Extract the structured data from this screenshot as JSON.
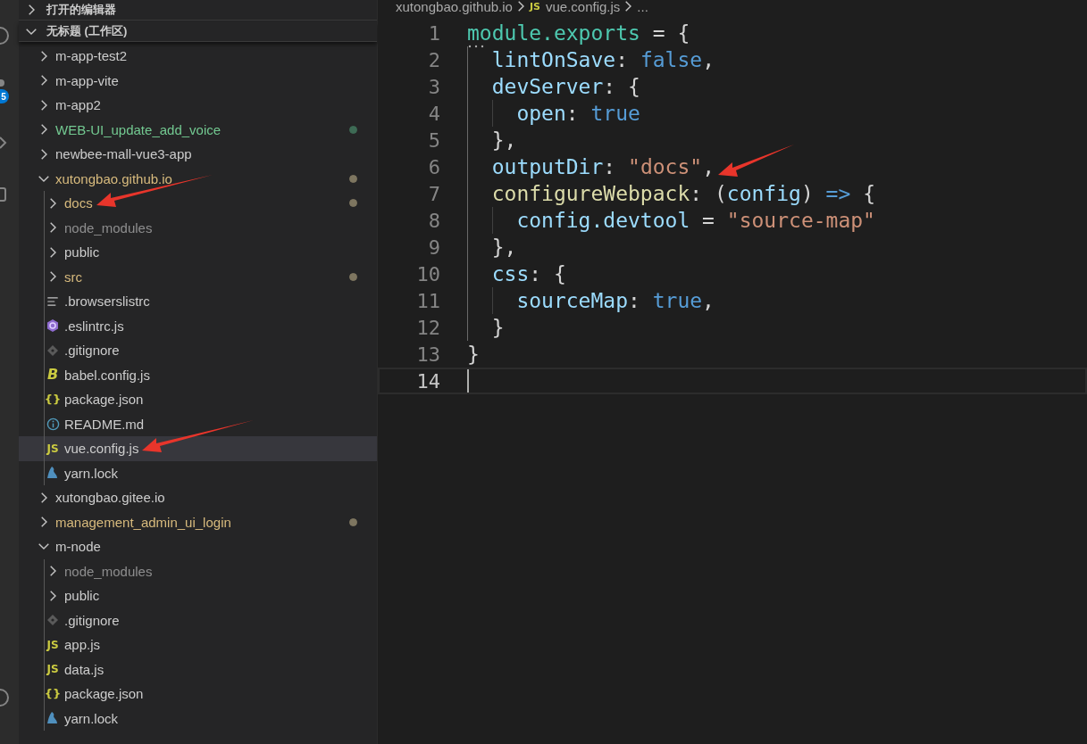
{
  "activity_bar": {
    "badge": "5"
  },
  "sidebar": {
    "sections": [
      {
        "title": "打开的编辑器",
        "expanded": false
      },
      {
        "title": "无标题 (工作区)",
        "expanded": true
      }
    ],
    "tree": [
      {
        "name": "m-app-test2",
        "kind": "folder",
        "expanded": false,
        "modified": false,
        "untracked": false,
        "ignored": false,
        "selected": false,
        "arrow": false
      },
      {
        "name": "m-app-vite",
        "kind": "folder",
        "expanded": false,
        "modified": false,
        "untracked": false,
        "ignored": false,
        "selected": false,
        "arrow": false
      },
      {
        "name": "m-app2",
        "kind": "folder",
        "expanded": false,
        "modified": false,
        "untracked": false,
        "ignored": false,
        "selected": false,
        "arrow": false
      },
      {
        "name": "WEB-UI_update_add_voice",
        "kind": "folder",
        "expanded": false,
        "modified": false,
        "untracked": true,
        "ignored": false,
        "selected": false,
        "arrow": false
      },
      {
        "name": "newbee-mall-vue3-app",
        "kind": "folder",
        "expanded": false,
        "modified": false,
        "untracked": false,
        "ignored": false,
        "selected": false,
        "arrow": false
      },
      {
        "name": "xutongbao.github.io",
        "kind": "folder",
        "expanded": true,
        "modified": true,
        "untracked": false,
        "ignored": false,
        "selected": false,
        "arrow": false,
        "children": [
          {
            "name": "docs",
            "kind": "folder",
            "expanded": false,
            "modified": true,
            "untracked": false,
            "ignored": false,
            "selected": false,
            "arrow": true
          },
          {
            "name": "node_modules",
            "kind": "folder",
            "expanded": false,
            "modified": false,
            "untracked": false,
            "ignored": true,
            "selected": false,
            "arrow": false
          },
          {
            "name": "public",
            "kind": "folder",
            "expanded": false,
            "modified": false,
            "untracked": false,
            "ignored": false,
            "selected": false,
            "arrow": false
          },
          {
            "name": "src",
            "kind": "folder",
            "expanded": false,
            "modified": true,
            "untracked": false,
            "ignored": false,
            "selected": false,
            "arrow": false
          },
          {
            "name": ".browserslistrc",
            "kind": "lines",
            "modified": false,
            "untracked": false,
            "ignored": false,
            "selected": false,
            "arrow": false
          },
          {
            "name": ".eslintrc.js",
            "kind": "eslint",
            "modified": false,
            "untracked": false,
            "ignored": false,
            "selected": false,
            "arrow": false
          },
          {
            "name": ".gitignore",
            "kind": "git",
            "modified": false,
            "untracked": false,
            "ignored": false,
            "selected": false,
            "arrow": false
          },
          {
            "name": "babel.config.js",
            "kind": "babel",
            "icon_text": "B",
            "modified": false,
            "untracked": false,
            "ignored": false,
            "selected": false,
            "arrow": false
          },
          {
            "name": "package.json",
            "kind": "json",
            "icon_text": "{}",
            "modified": false,
            "untracked": false,
            "ignored": false,
            "selected": false,
            "arrow": false
          },
          {
            "name": "README.md",
            "kind": "info",
            "modified": false,
            "untracked": false,
            "ignored": false,
            "selected": false,
            "arrow": false
          },
          {
            "name": "vue.config.js",
            "kind": "js",
            "icon_text": "JS",
            "modified": false,
            "untracked": false,
            "ignored": false,
            "selected": true,
            "arrow": true
          },
          {
            "name": "yarn.lock",
            "kind": "yarn",
            "modified": false,
            "untracked": false,
            "ignored": false,
            "selected": false,
            "arrow": false
          }
        ]
      },
      {
        "name": "xutongbao.gitee.io",
        "kind": "folder",
        "expanded": false,
        "modified": false,
        "untracked": false,
        "ignored": false,
        "selected": false,
        "arrow": false
      },
      {
        "name": "management_admin_ui_login",
        "kind": "folder",
        "expanded": false,
        "modified": true,
        "untracked": false,
        "ignored": false,
        "selected": false,
        "arrow": false
      },
      {
        "name": "m-node",
        "kind": "folder",
        "expanded": true,
        "modified": false,
        "untracked": false,
        "ignored": false,
        "selected": false,
        "arrow": false,
        "children": [
          {
            "name": "node_modules",
            "kind": "folder",
            "expanded": false,
            "modified": false,
            "untracked": false,
            "ignored": true,
            "selected": false,
            "arrow": false
          },
          {
            "name": "public",
            "kind": "folder",
            "expanded": false,
            "modified": false,
            "untracked": false,
            "ignored": false,
            "selected": false,
            "arrow": false
          },
          {
            "name": ".gitignore",
            "kind": "git",
            "modified": false,
            "untracked": false,
            "ignored": false,
            "selected": false,
            "arrow": false
          },
          {
            "name": "app.js",
            "kind": "js",
            "icon_text": "JS",
            "modified": false,
            "untracked": false,
            "ignored": false,
            "selected": false,
            "arrow": false
          },
          {
            "name": "data.js",
            "kind": "js",
            "icon_text": "JS",
            "modified": false,
            "untracked": false,
            "ignored": false,
            "selected": false,
            "arrow": false
          },
          {
            "name": "package.json",
            "kind": "json",
            "icon_text": "{}",
            "modified": false,
            "untracked": false,
            "ignored": false,
            "selected": false,
            "arrow": false
          },
          {
            "name": "yarn.lock",
            "kind": "yarn",
            "modified": false,
            "untracked": false,
            "ignored": false,
            "selected": false,
            "arrow": false
          }
        ]
      }
    ]
  },
  "editor": {
    "breadcrumb": [
      {
        "text": "xutongbao.github.io"
      },
      {
        "text": "vue.config.js",
        "icon_text": "JS"
      },
      {
        "text": "..."
      }
    ],
    "lines": [
      {
        "number": "1",
        "hint": true,
        "current": false,
        "arrow": false,
        "tokens": [
          {
            "kind": "type",
            "text": "module.exports"
          },
          {
            "kind": "punct",
            "text": " = {"
          }
        ]
      },
      {
        "number": "2",
        "hint": false,
        "current": false,
        "arrow": false,
        "tokens": [
          {
            "kind": "prop",
            "text": "  lintOnSave"
          },
          {
            "kind": "punct",
            "text": ": "
          },
          {
            "kind": "keyword",
            "text": "false"
          },
          {
            "kind": "punct",
            "text": ","
          }
        ]
      },
      {
        "number": "3",
        "hint": false,
        "current": false,
        "arrow": false,
        "tokens": [
          {
            "kind": "prop",
            "text": "  devServer"
          },
          {
            "kind": "punct",
            "text": ": {"
          }
        ]
      },
      {
        "number": "4",
        "hint": false,
        "current": false,
        "arrow": false,
        "tokens": [
          {
            "kind": "prop",
            "text": "    open"
          },
          {
            "kind": "punct",
            "text": ": "
          },
          {
            "kind": "keyword",
            "text": "true"
          }
        ]
      },
      {
        "number": "5",
        "hint": false,
        "current": false,
        "arrow": false,
        "tokens": [
          {
            "kind": "punct",
            "text": "  },"
          }
        ]
      },
      {
        "number": "6",
        "hint": false,
        "current": false,
        "arrow": true,
        "tokens": [
          {
            "kind": "prop",
            "text": "  outputDir"
          },
          {
            "kind": "punct",
            "text": ": "
          },
          {
            "kind": "string",
            "text": "\"docs\""
          },
          {
            "kind": "punct",
            "text": ","
          }
        ]
      },
      {
        "number": "7",
        "hint": false,
        "current": false,
        "arrow": false,
        "tokens": [
          {
            "kind": "function",
            "text": "  configureWebpack"
          },
          {
            "kind": "punct",
            "text": ": ("
          },
          {
            "kind": "prop",
            "text": "config"
          },
          {
            "kind": "punct",
            "text": ") "
          },
          {
            "kind": "keyword",
            "text": "=>"
          },
          {
            "kind": "punct",
            "text": " {"
          }
        ]
      },
      {
        "number": "8",
        "hint": false,
        "current": false,
        "arrow": false,
        "tokens": [
          {
            "kind": "prop",
            "text": "    config.devtool"
          },
          {
            "kind": "punct",
            "text": " = "
          },
          {
            "kind": "string",
            "text": "\"source-map\""
          }
        ]
      },
      {
        "number": "9",
        "hint": false,
        "current": false,
        "arrow": false,
        "tokens": [
          {
            "kind": "punct",
            "text": "  },"
          }
        ]
      },
      {
        "number": "10",
        "hint": false,
        "current": false,
        "arrow": false,
        "tokens": [
          {
            "kind": "prop",
            "text": "  css"
          },
          {
            "kind": "punct",
            "text": ": {"
          }
        ]
      },
      {
        "number": "11",
        "hint": false,
        "current": false,
        "arrow": false,
        "tokens": [
          {
            "kind": "prop",
            "text": "    sourceMap"
          },
          {
            "kind": "punct",
            "text": ": "
          },
          {
            "kind": "keyword",
            "text": "true"
          },
          {
            "kind": "punct",
            "text": ","
          }
        ]
      },
      {
        "number": "12",
        "hint": false,
        "current": false,
        "arrow": false,
        "tokens": [
          {
            "kind": "punct",
            "text": "  }"
          }
        ]
      },
      {
        "number": "13",
        "hint": false,
        "current": false,
        "arrow": false,
        "tokens": [
          {
            "kind": "punct",
            "text": "}"
          }
        ]
      },
      {
        "number": "14",
        "hint": false,
        "current": true,
        "arrow": false
      }
    ]
  }
}
